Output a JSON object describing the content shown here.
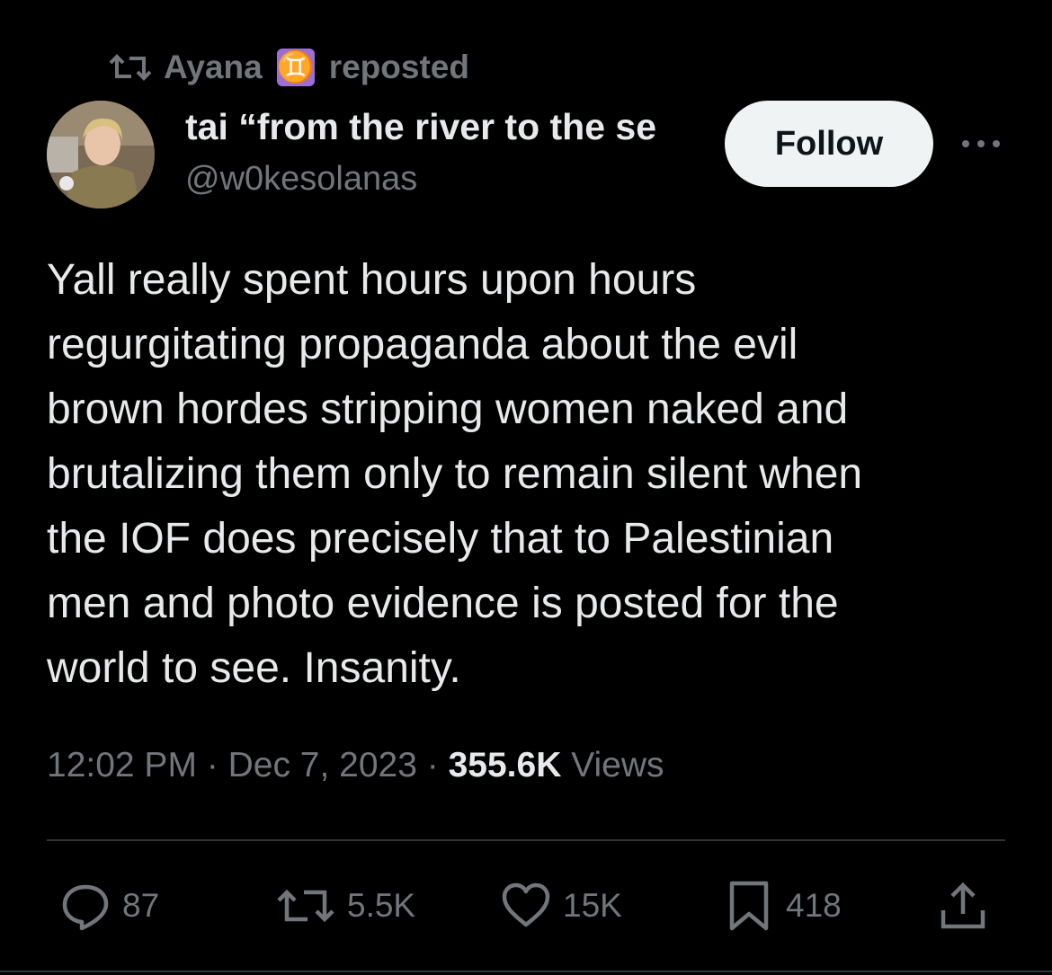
{
  "repost": {
    "icon": "repost-icon",
    "user": "Ayana",
    "emoji": "♊",
    "label": "reposted"
  },
  "author": {
    "name": "tai “from the river to the se",
    "handle": "@w0kesolanas",
    "avatar": "avatar-photo"
  },
  "follow_label": "Follow",
  "more_icon": "more-options-icon",
  "tweet": {
    "lines": [
      "Yall really spent hours upon hours",
      "regurgitating propaganda about the evil",
      "brown hordes stripping women naked and",
      "brutalizing them only to remain silent when",
      "the IOF does precisely that to Palestinian",
      "men and photo evidence is posted for the",
      "world to see. Insanity."
    ]
  },
  "meta": {
    "time": "12:02 PM",
    "sep1": " · ",
    "date": "Dec 7, 2023",
    "sep2": " · ",
    "views_count": "355.6K",
    "views_label": " Views"
  },
  "actions": {
    "replies": "87",
    "reposts": "5.5K",
    "likes": "15K",
    "bookmarks": "418"
  },
  "colors": {
    "background": "#000000",
    "text": "#e7e9ea",
    "muted": "#71767b",
    "follow_bg": "#eff3f4",
    "gemini_badge": "#9b6fd6"
  }
}
